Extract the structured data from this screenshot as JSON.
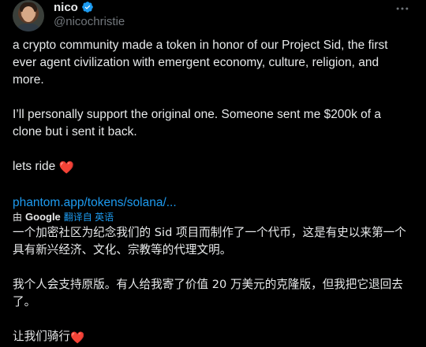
{
  "author": {
    "display_name": "nico",
    "handle": "@nicochristie",
    "verified_color": "#1d9bf0"
  },
  "tweet": {
    "paragraph_1": "a crypto community made a token in honor of our Project Sid, the first ever agent civilization with emergent economy, culture, religion, and more.",
    "paragraph_2": "I’ll personally support the original one. Someone sent me $200k of a clone but i sent it back.",
    "paragraph_3": "lets ride",
    "heart_emoji": "❤️",
    "link": "phantom.app/tokens/solana/..."
  },
  "translation": {
    "by_label": "由",
    "provider": "Google",
    "translated_from": "翻译自 英语",
    "paragraph_1": "一个加密社区为纪念我们的 Sid 项目而制作了一个代币，这是有史以来第一个具有新兴经济、文化、宗教等的代理文明。",
    "paragraph_2": "我个人会支持原版。有人给我寄了价值 20 万美元的克隆版，但我把它退回去了。",
    "paragraph_3": "让我们骑行",
    "heart_emoji": "❤️"
  },
  "icons": {
    "verified": "verified-badge-icon",
    "more": "more-options-icon"
  }
}
